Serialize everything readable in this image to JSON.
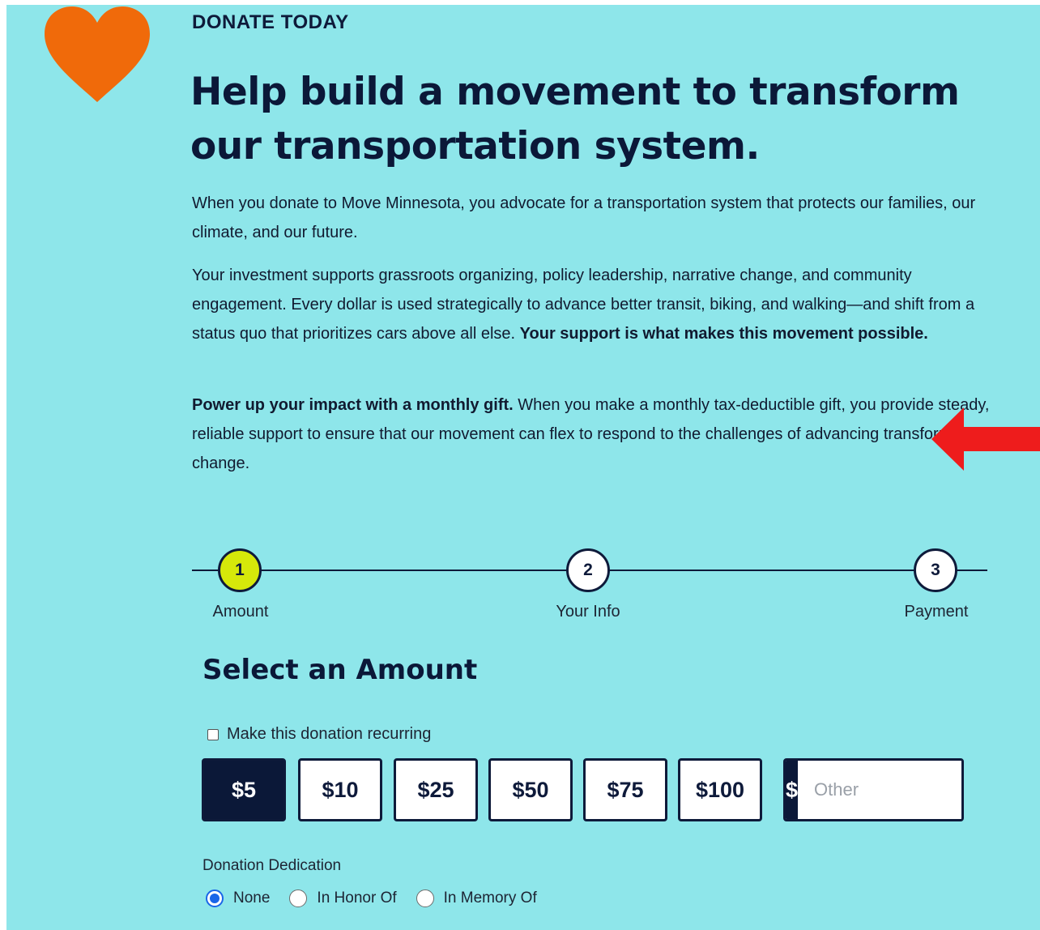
{
  "colors": {
    "panel_bg": "#8ee6ea",
    "heart": "#f06a0a",
    "navy": "#0b1838",
    "step_active": "#d6e80a",
    "arrow": "#ee1c1c",
    "radio_checked": "#1a66e8"
  },
  "icons": {
    "logo": "heart-icon",
    "annotation": "red-arrow-icon"
  },
  "header": {
    "eyebrow": "DONATE TODAY",
    "headline": "Help build a movement to transform our transportation system."
  },
  "intro": {
    "p1": "When you donate to Move Minnesota, you advocate for a transportation system that protects our families, our climate, and our future.",
    "p2_text": "Your investment supports grassroots organizing, policy leadership, narrative change, and community engagement. Every dollar is used strategically to advance better transit, biking, and walking—and shift from a status quo that prioritizes cars above all else. ",
    "p2_bold": "Your support is what makes this movement possible.",
    "p3_bold": "Power up your impact with a monthly gift.",
    "p3_text": " When you make a monthly tax-deductible gift, you provide steady, reliable support to ensure that our movement can flex to respond to the challenges of advancing transformative change."
  },
  "stepper": {
    "current_step": 1,
    "steps": [
      {
        "number": "1",
        "label": "Amount"
      },
      {
        "number": "2",
        "label": "Your Info"
      },
      {
        "number": "3",
        "label": "Payment"
      }
    ]
  },
  "form": {
    "section_title": "Select an Amount",
    "recurring_label": "Make this donation recurring",
    "recurring_checked": false,
    "amounts": [
      "$5",
      "$10",
      "$25",
      "$50",
      "$75",
      "$100"
    ],
    "selected_amount": "$5",
    "other_currency": "$",
    "other_placeholder": "Other",
    "other_value": "",
    "dedication_label": "Donation Dedication",
    "dedication_options": [
      "None",
      "In Honor Of",
      "In Memory Of"
    ],
    "dedication_selected": "None"
  }
}
